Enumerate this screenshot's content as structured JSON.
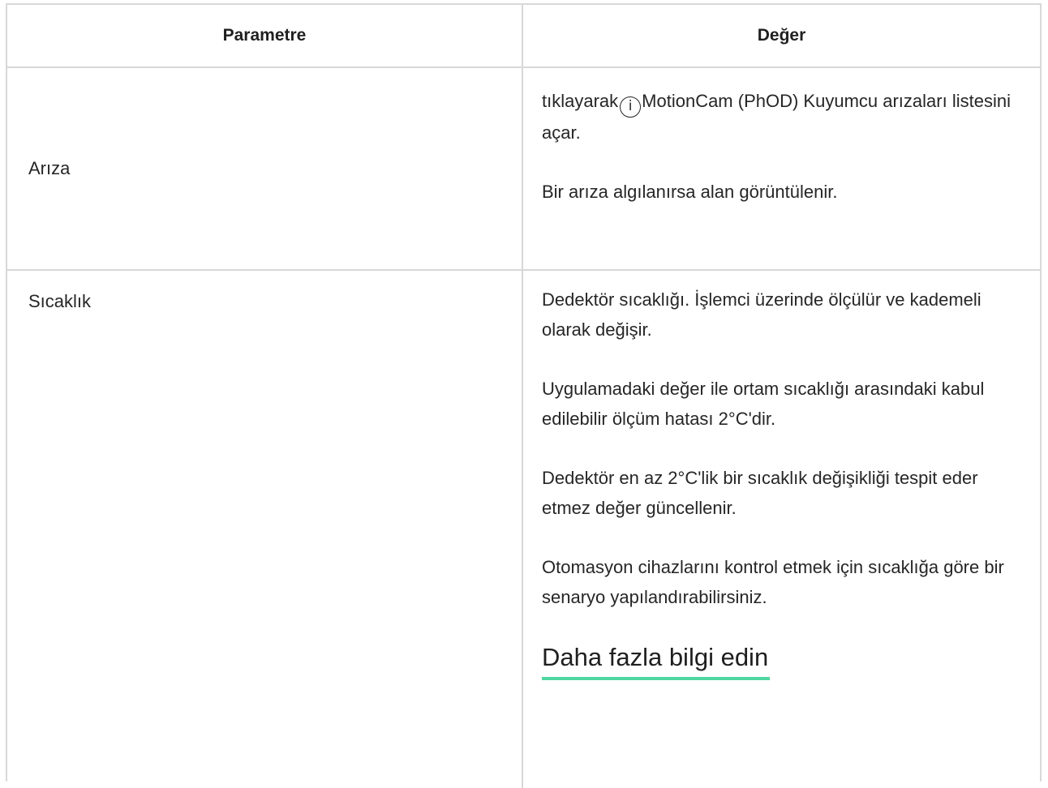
{
  "table": {
    "headers": {
      "parameter": "Parametre",
      "value": "Değer"
    },
    "rows": [
      {
        "parameter": "Arıza",
        "value": {
          "p1_before_icon": "tıklayarak",
          "p1_icon_glyph": "i",
          "p1_after_icon": "MotionCam (PhOD) Kuyumcu arızaları listesini açar.",
          "p2": "Bir arıza algılanırsa alan görüntülenir."
        }
      },
      {
        "parameter": "Sıcaklık",
        "value": {
          "p1": "Dedektör sıcaklığı. İşlemci üzerinde ölçülür ve kademeli olarak değişir.",
          "p2": "Uygulamadaki değer ile ortam sıcaklığı arasındaki kabul edilebilir ölçüm hatası 2°C'dir.",
          "p3": "Dedektör en az 2°C'lik bir sıcaklık değişikliği tespit eder etmez değer güncellenir.",
          "p4": "Otomasyon cihazlarını kontrol etmek için sıcaklığa göre bir senaryo yapılandırabilirsiniz.",
          "link": "Daha fazla bilgi edin"
        }
      }
    ]
  },
  "colors": {
    "border": "#d8d8d8",
    "text": "#262626",
    "link_underline": "#4fd6a0"
  }
}
